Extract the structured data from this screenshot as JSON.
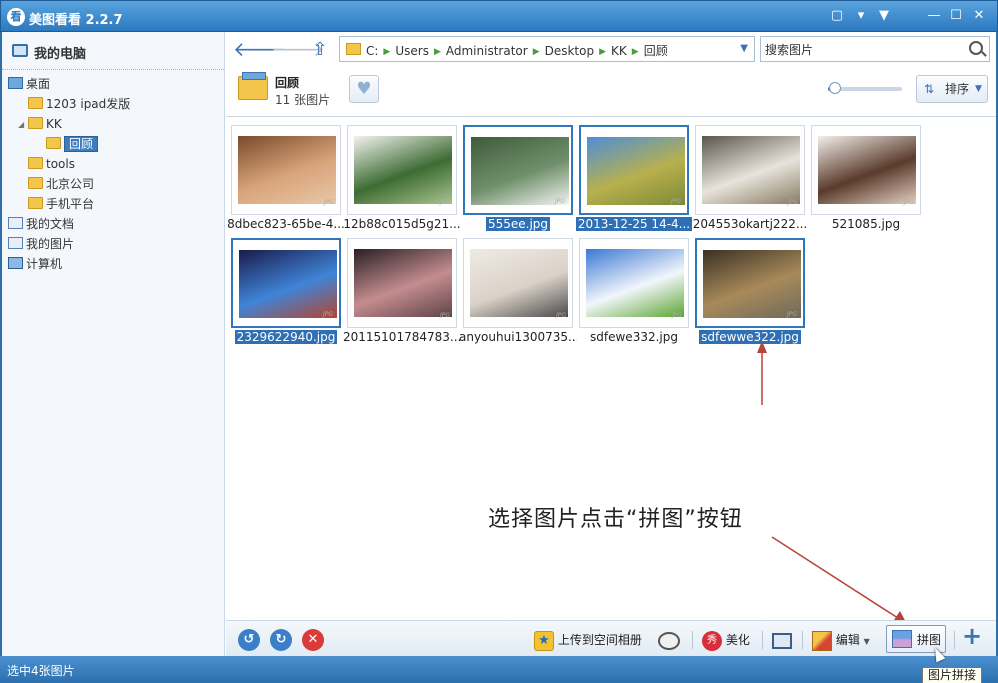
{
  "window": {
    "title": "美图看看 2.2.7",
    "logo_glyph": "看"
  },
  "window_controls": {
    "chat": "▢",
    "menu": "▾",
    "skin": "▼",
    "minimize": "—",
    "maximize": "☐",
    "close": "✕"
  },
  "sidebar": {
    "title": "我的电脑",
    "items": [
      {
        "label": "桌面",
        "type": "desktop"
      },
      {
        "label": "1203 ipad发版",
        "type": "folder"
      },
      {
        "label": "KK",
        "type": "folder"
      },
      {
        "label": "回顾",
        "type": "folder",
        "selected": true
      },
      {
        "label": "tools",
        "type": "folder"
      },
      {
        "label": "北京公司",
        "type": "folder"
      },
      {
        "label": "手机平台",
        "type": "folder"
      },
      {
        "label": "我的文档",
        "type": "doc"
      },
      {
        "label": "我的图片",
        "type": "doc"
      },
      {
        "label": "计算机",
        "type": "pc"
      }
    ]
  },
  "nav": {
    "back_glyph": "🡐",
    "forward_glyph": "🡒",
    "up_glyph": "⇧"
  },
  "address": {
    "crumbs": [
      "C:",
      "Users",
      "Administrator",
      "Desktop",
      "KK",
      "回顾"
    ],
    "separator": "▶"
  },
  "search": {
    "value": "搜索图片"
  },
  "folder": {
    "name": "回顾",
    "count": "11 张图片"
  },
  "toolbar": {
    "fav_glyph": "♥",
    "sort_label": "排序",
    "sort_icon": "⇅",
    "zoom_level": 0.1
  },
  "thumbnails": [
    {
      "label": "8dbec823-65be-4...",
      "selected": false,
      "colors": [
        "#7a4a2c",
        "#d8a47a",
        "#e9c7a8"
      ]
    },
    {
      "label": "12b88c015d5g21...",
      "selected": false,
      "colors": [
        "#f3f3ef",
        "#3d6c33",
        "#a9c28d"
      ]
    },
    {
      "label": "555ee.jpg",
      "selected": true,
      "colors": [
        "#3f5b3a",
        "#6f8f6a",
        "#f4f4f2"
      ]
    },
    {
      "label": "2013-12-25 14-4...",
      "selected": true,
      "colors": [
        "#4d8fd6",
        "#b8b04e",
        "#7c8a35"
      ]
    },
    {
      "label": "204553okartj222...",
      "selected": false,
      "colors": [
        "#59544c",
        "#e8e4dc",
        "#877b62"
      ]
    },
    {
      "label": "521085.jpg",
      "selected": false,
      "colors": [
        "#f4eeea",
        "#5a3b2c",
        "#e2cfc0"
      ]
    },
    {
      "label": "2329622940.jpg",
      "selected": true,
      "colors": [
        "#1a1b4a",
        "#3f84d8",
        "#b44530"
      ]
    },
    {
      "label": "20115101784783...",
      "selected": false,
      "colors": [
        "#2a1f24",
        "#c48d8f",
        "#5f4348"
      ]
    },
    {
      "label": "anyouhui1300735...",
      "selected": false,
      "colors": [
        "#efeae4",
        "#dad2c8",
        "#4a4a4a"
      ]
    },
    {
      "label": "sdfewe332.jpg",
      "selected": false,
      "colors": [
        "#3b78d4",
        "#f2f6fb",
        "#5ca531"
      ]
    },
    {
      "label": "sdfewwe322.jpg",
      "selected": true,
      "colors": [
        "#3a3123",
        "#a88a5a",
        "#6e6a5a"
      ]
    }
  ],
  "annotation": {
    "text": "选择图片点击“拼图”按钮"
  },
  "bottombar": {
    "rotate_left_glyph": "↺",
    "rotate_right_glyph": "↻",
    "delete_glyph": "✕",
    "upload_label": "上传到空间相册",
    "beautify_label": "美化",
    "edit_label": "编辑",
    "pintu_label": "拼图",
    "add_glyph": "+"
  },
  "status": {
    "text": "选中4张图片"
  },
  "tooltip": {
    "text": "图片拼接"
  }
}
